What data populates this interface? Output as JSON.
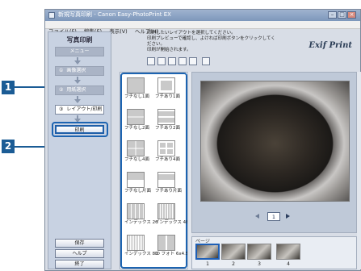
{
  "window": {
    "title": "新規写真印刷 - Canon Easy-PhotoPrint EX",
    "menus": [
      "ファイル(F)",
      "編集(E)",
      "表示(V)",
      "ヘルプ(H)"
    ]
  },
  "sidebar": {
    "title": "写真印刷",
    "menu_label": "メニュー",
    "steps": [
      {
        "num": "①",
        "label": "画像選択"
      },
      {
        "num": "②",
        "label": "用紙選択"
      },
      {
        "num": "③",
        "label": "レイアウト/印刷"
      }
    ],
    "print_label": "印刷",
    "save_label": "保存",
    "help_label": "ヘルプ",
    "exit_label": "終了"
  },
  "instructions": {
    "line1": "印刷したいレイアウトを選択してください。",
    "line2": "印刷プレビューで確認し、よければ印刷ボタンをクリックしてください。",
    "line3": "印刷が開始されます。"
  },
  "brand": {
    "logo": "Exif Print"
  },
  "layouts": [
    {
      "label": "フチなし1面"
    },
    {
      "label": "フチあり1面"
    },
    {
      "label": "フチなし2面"
    },
    {
      "label": "フチあり2面"
    },
    {
      "label": "フチなし4面"
    },
    {
      "label": "フチあり4面"
    },
    {
      "label": "フチなし片面"
    },
    {
      "label": "フチあり片面"
    },
    {
      "label": "インデックス 20"
    },
    {
      "label": "インデックス 48"
    },
    {
      "label": "インデックス 80"
    },
    {
      "label": "ID フォト 6x4.5cm"
    }
  ],
  "preview": {
    "page": "1"
  },
  "pages": {
    "label": "ページ",
    "items": [
      "1",
      "2",
      "3",
      "4"
    ]
  },
  "callouts": {
    "one": "1",
    "two": "2"
  }
}
